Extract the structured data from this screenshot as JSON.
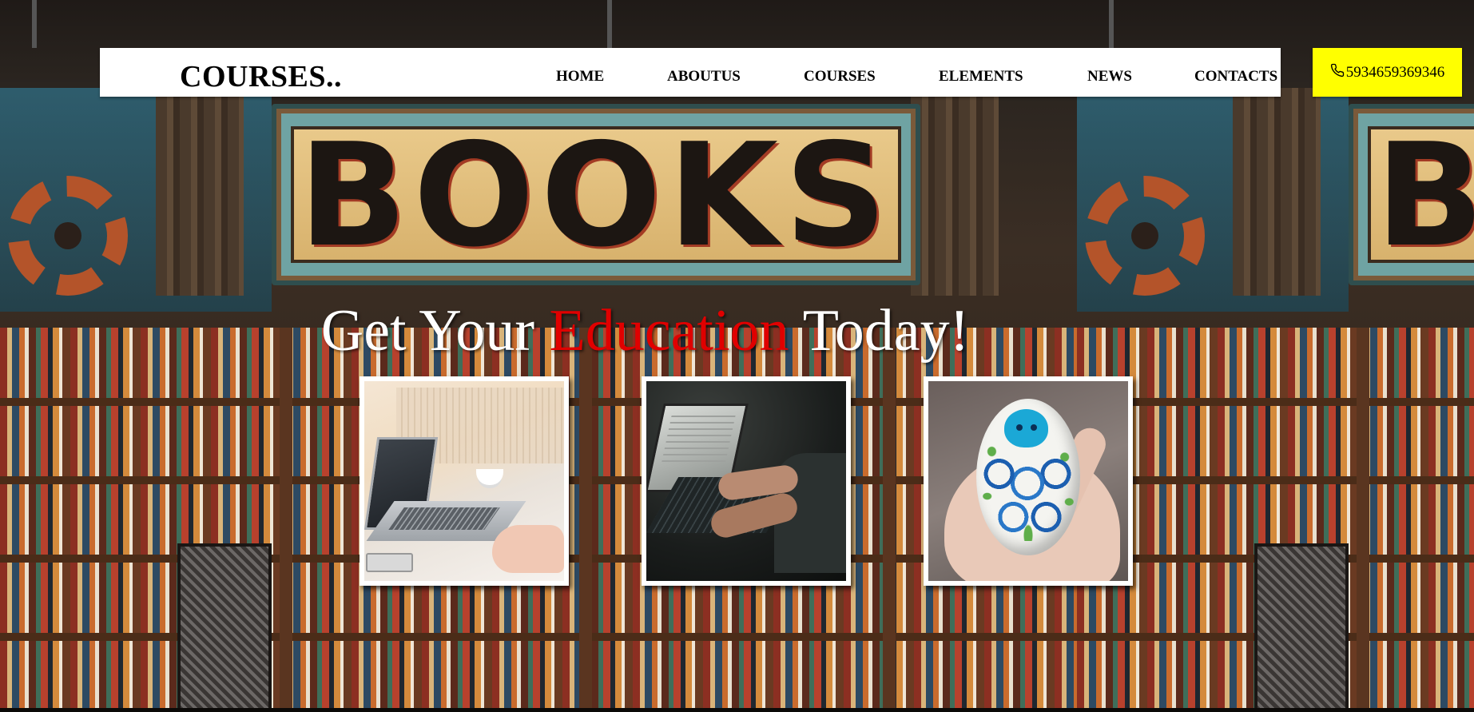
{
  "brand": {
    "name": "COURSES.."
  },
  "nav": {
    "items": [
      {
        "label": "HOME"
      },
      {
        "label": "ABOUTUS"
      },
      {
        "label": "COURSES"
      },
      {
        "label": "ELEMENTS"
      },
      {
        "label": "NEWS"
      },
      {
        "label": "CONTACTS"
      }
    ]
  },
  "phone": {
    "icon": "phone-icon",
    "number": "5934659369346"
  },
  "hero": {
    "title_prefix": "Get Your ",
    "title_accent": "Education",
    "title_suffix": " Today!"
  },
  "background": {
    "sign_text": "BOOKS"
  },
  "cards": [
    {
      "subject": "laptop-desk-photo"
    },
    {
      "subject": "typing-laptop-photo"
    },
    {
      "subject": "octopus-stone-photo"
    }
  ],
  "colors": {
    "navbar_bg": "#ffffff",
    "phone_bg": "#ffff00",
    "accent_red": "#e00000",
    "hero_text": "#ffffff"
  }
}
